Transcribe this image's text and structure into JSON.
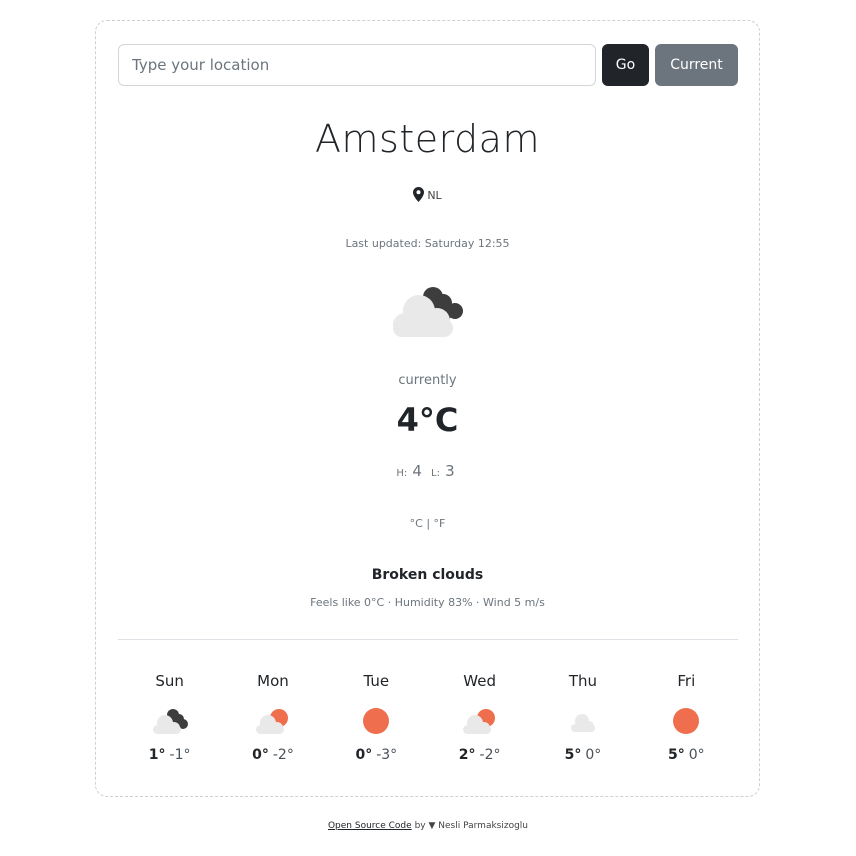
{
  "search": {
    "placeholder": "Type your location",
    "value": ""
  },
  "buttons": {
    "go": "Go",
    "current": "Current"
  },
  "location": {
    "city": "Amsterdam",
    "country": "NL"
  },
  "last_updated": "Last updated: Saturday 12:55",
  "current": {
    "icon": "broken-clouds-icon",
    "label": "currently",
    "temp": "4°C",
    "high_label": "H:",
    "high": "4",
    "low_label": "L:",
    "low": "3",
    "unit_c": "°C",
    "unit_sep": "|",
    "unit_f": "°F",
    "description": "Broken clouds",
    "details": "Feels like 0°C · Humidity 83% · Wind 5 m/s"
  },
  "forecast": [
    {
      "day": "Sun",
      "icon": "broken-clouds-icon",
      "hi": "1°",
      "lo": "-1°"
    },
    {
      "day": "Mon",
      "icon": "few-clouds-icon",
      "hi": "0°",
      "lo": "-2°"
    },
    {
      "day": "Tue",
      "icon": "clear-sky-icon",
      "hi": "0°",
      "lo": "-3°"
    },
    {
      "day": "Wed",
      "icon": "few-clouds-icon",
      "hi": "2°",
      "lo": "-2°"
    },
    {
      "day": "Thu",
      "icon": "cloud-icon",
      "hi": "5°",
      "lo": "0°"
    },
    {
      "day": "Fri",
      "icon": "clear-sky-icon",
      "hi": "5°",
      "lo": "0°"
    }
  ],
  "footer": {
    "link": "Open Source Code",
    "by": "by",
    "author": "Nesli Parmaksizoglu"
  },
  "colors": {
    "sun": "#ee6e4d",
    "cloud_light": "#e9e9e9",
    "cloud_dark": "#3d3d3d",
    "button_dark": "#212529",
    "button_gray": "#6c757d"
  }
}
